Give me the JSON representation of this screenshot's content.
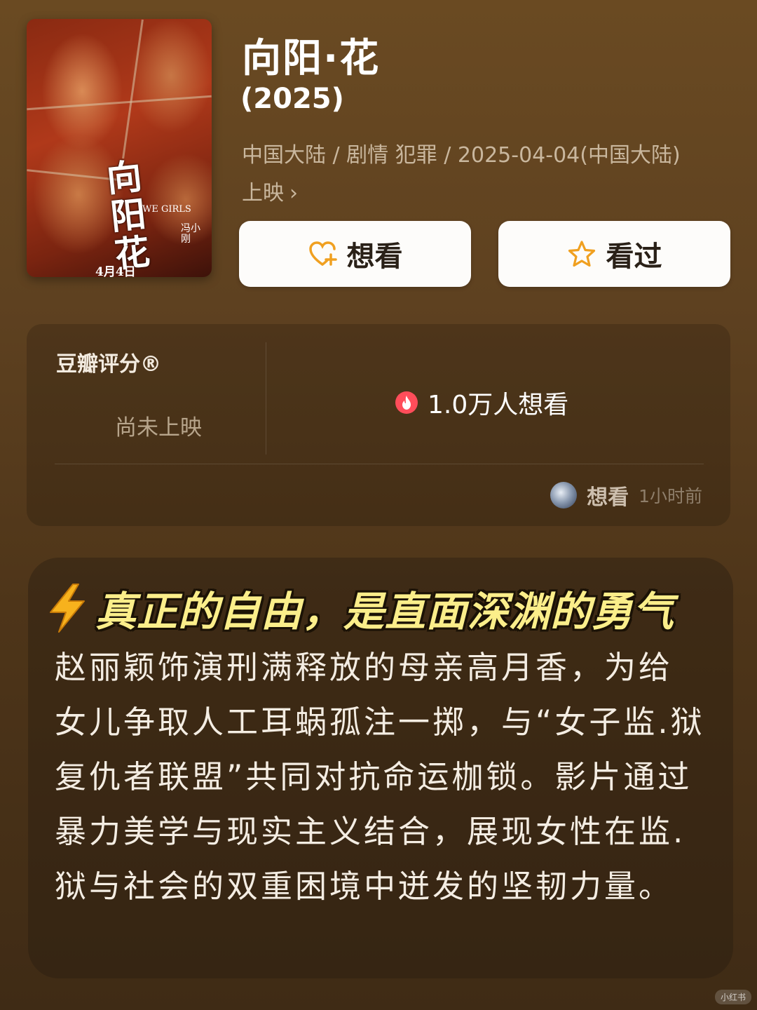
{
  "movie": {
    "title": "向阳·花",
    "year": "(2025)",
    "meta_line1": "中国大陆 / 剧情 犯罪 / 2025-04-04(中国大陆)",
    "meta_line2": "上映",
    "poster": {
      "title_text": "向阳花",
      "english_title": "WE GIRLS",
      "release_text": "4月4日",
      "credit_text": "冯小刚"
    }
  },
  "actions": {
    "wish_label": "想看",
    "seen_label": "看过"
  },
  "rating": {
    "label": "豆瓣评分®",
    "status": "尚未上映",
    "wish_count": "1.0万人想看",
    "activity_action": "想看",
    "activity_time": "1小时前"
  },
  "description": {
    "headline": "真正的自由，是直面深渊的勇气",
    "body": "赵丽颖饰演刑满释放的母亲高月香，为给女儿争取人工耳蜗孤注一掷，与“女子监.狱复仇者联盟”共同对抗命运枷锁。影片通过暴力美学与现实主义结合，展现女性在监.狱与社会的双重困境中迸发的坚韧力量。"
  },
  "watermark": "小红书",
  "colors": {
    "background_top": "#6a4a22",
    "background_bottom": "#3f2b15",
    "headline": "#fbee8a",
    "wish_icon": "#f0a020",
    "fire_badge": "#ff4d5a"
  },
  "icons": {
    "wish": "heart-plus-icon",
    "seen": "star-outline-icon",
    "hot": "fire-icon",
    "headline": "lightning-bolt-icon",
    "meta_more": "chevron-right-icon"
  }
}
